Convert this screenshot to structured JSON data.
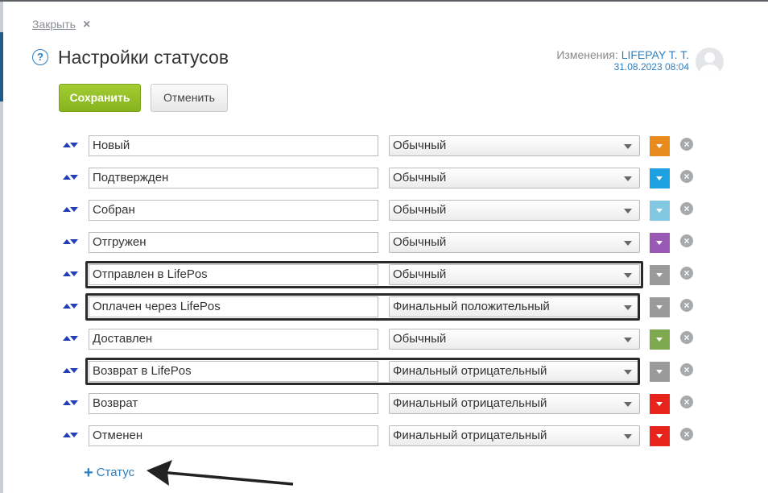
{
  "dialog": {
    "close_label": "Закрыть",
    "close_icon": "×",
    "help_icon": "?",
    "title": "Настройки статусов",
    "changes_prefix": "Изменения:",
    "changes_user": "LIFEPAY T. T.",
    "changes_date": "31.08.2023 08:04"
  },
  "buttons": {
    "save_label": "Сохранить",
    "cancel_label": "Отменить"
  },
  "statuses": [
    {
      "name": "Новый",
      "type": "Обычный",
      "color": "#e98b1c"
    },
    {
      "name": "Подтвержден",
      "type": "Обычный",
      "color": "#1da1e0"
    },
    {
      "name": "Собран",
      "type": "Обычный",
      "color": "#82c8e2"
    },
    {
      "name": "Отгружен",
      "type": "Обычный",
      "color": "#9b59b6"
    },
    {
      "name": "Отправлен в LifePos",
      "type": "Обычный",
      "color": "#9a9a9a"
    },
    {
      "name": "Оплачен через LifePos",
      "type": "Финальный положительный",
      "color": "#9a9a9a"
    },
    {
      "name": "Доставлен",
      "type": "Обычный",
      "color": "#7fa94e"
    },
    {
      "name": "Возврат в LifePos",
      "type": "Финальный отрицательный",
      "color": "#9a9a9a"
    },
    {
      "name": "Возврат",
      "type": "Финальный отрицательный",
      "color": "#e8231c"
    },
    {
      "name": "Отменен",
      "type": "Финальный отрицательный",
      "color": "#e8231c"
    }
  ],
  "add_status_label": "Статус",
  "add_status_icon": "+",
  "delete_icon": "×"
}
